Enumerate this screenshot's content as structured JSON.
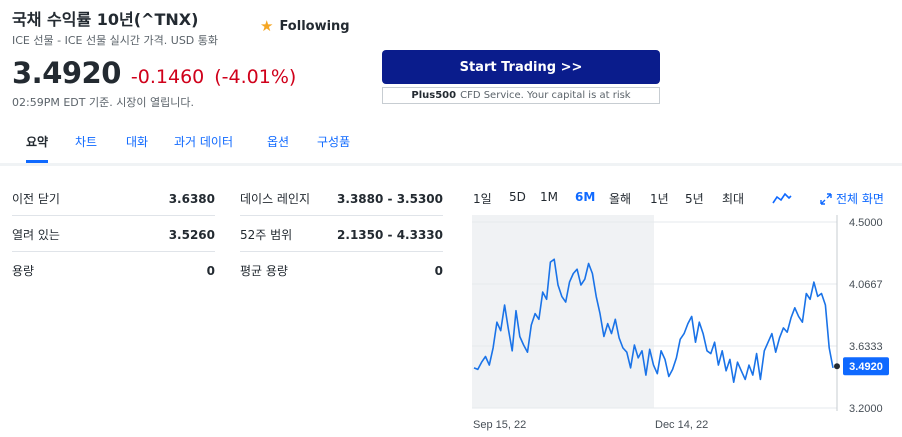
{
  "quote": {
    "title": "국채 수익률 10년(^TNX)",
    "subtitle": "ICE 선물 - ICE 선물 실시간 가격. USD 통화",
    "follow_label": "Following",
    "price": "3.4920",
    "change": "-0.1460",
    "change_pct": "(-4.01%)",
    "as_of": "02:59PM EDT 기준. 시장이 열립니다."
  },
  "promo": {
    "button_label": "Start Trading >>",
    "brand": "Plus500",
    "disclaimer": "CFD Service. Your capital is at risk"
  },
  "tabs": [
    "요약",
    "차트",
    "대화",
    "과거 데이터",
    "옵션",
    "구성품"
  ],
  "stats": {
    "left": [
      {
        "label": "이전 닫기",
        "value": "3.6380"
      },
      {
        "label": "열려 있는",
        "value": "3.5260"
      },
      {
        "label": "용량",
        "value": "0"
      }
    ],
    "right": [
      {
        "label": "데이스 레인지",
        "value": "3.3880 - 3.5300"
      },
      {
        "label": "52주 범위",
        "value": "2.1350 - 4.3330"
      },
      {
        "label": "평균 용량",
        "value": "0"
      }
    ]
  },
  "ranges": [
    "1일",
    "5D",
    "1M",
    "6M",
    "올해",
    "1년",
    "5년",
    "최대"
  ],
  "fullscreen_label": "전체 화면",
  "colors": {
    "accent": "#0f69ff",
    "down": "#d0011b",
    "brand_button": "#0a1c8c",
    "line": "#1a73e8"
  },
  "chart_data": {
    "type": "line",
    "x_tick_labels": [
      "Sep 15, 22",
      "Dec 14, 22"
    ],
    "y_tick_labels": [
      "4.5000",
      "4.0667",
      "3.6333",
      "3.2000"
    ],
    "ylim": [
      3.2,
      4.5
    ],
    "current_label": "3.4920",
    "current_value": 3.492,
    "series": [
      {
        "values": [
          3.48,
          3.47,
          3.52,
          3.56,
          3.5,
          3.62,
          3.8,
          3.74,
          3.92,
          3.75,
          3.6,
          3.88,
          3.7,
          3.64,
          3.59,
          3.78,
          3.86,
          3.82,
          4.01,
          3.96,
          4.22,
          4.24,
          4.06,
          3.98,
          3.94,
          4.08,
          4.14,
          4.17,
          4.06,
          4.1,
          4.21,
          4.14,
          3.98,
          3.86,
          3.7,
          3.79,
          3.72,
          3.82,
          3.69,
          3.62,
          3.59,
          3.48,
          3.64,
          3.55,
          3.6,
          3.43,
          3.61,
          3.5,
          3.44,
          3.6,
          3.54,
          3.42,
          3.47,
          3.55,
          3.68,
          3.72,
          3.79,
          3.84,
          3.66,
          3.8,
          3.72,
          3.6,
          3.58,
          3.66,
          3.5,
          3.6,
          3.46,
          3.54,
          3.38,
          3.52,
          3.46,
          3.4,
          3.5,
          3.43,
          3.58,
          3.4,
          3.6,
          3.66,
          3.72,
          3.59,
          3.69,
          3.76,
          3.73,
          3.83,
          3.9,
          3.84,
          3.8,
          4.0,
          3.96,
          4.08,
          3.98,
          4.0,
          3.92,
          3.62,
          3.48
        ]
      }
    ]
  }
}
